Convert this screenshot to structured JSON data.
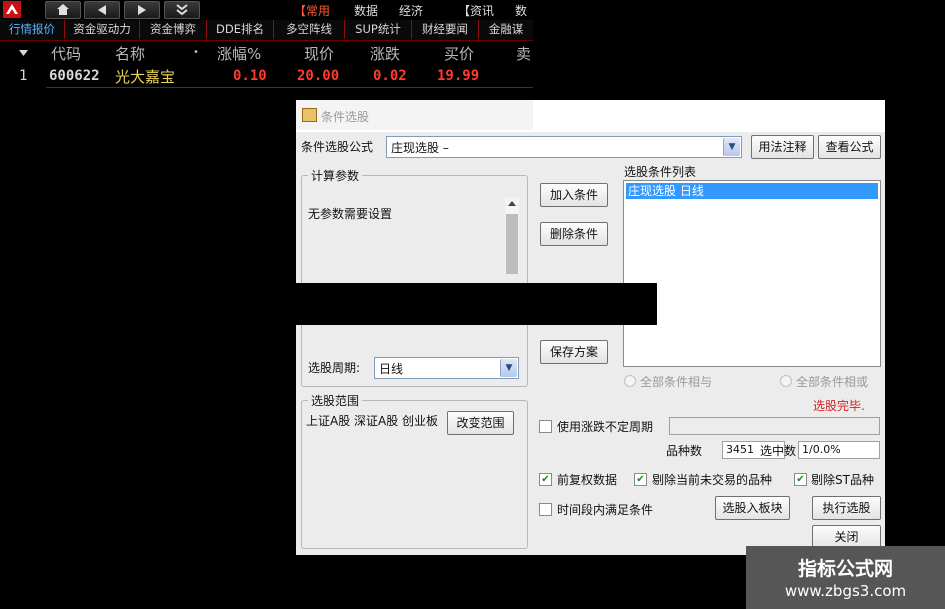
{
  "toolbar": {
    "home_icon": "home-icon",
    "back_icon": "triangle-left-icon",
    "forward_icon": "triangle-right-icon",
    "more_icon": "double-chevron-down-icon",
    "menu": [
      {
        "label": "【常用",
        "active": true
      },
      {
        "label": "数据"
      },
      {
        "label": "经济"
      },
      {
        "label": "【资讯"
      },
      {
        "label": "数"
      }
    ]
  },
  "tabs": [
    "行情报价",
    "资金驱动力",
    "资金博弈",
    "DDE排名",
    "多空阵线",
    "SUP统计",
    "财经要闻",
    "金融谋"
  ],
  "quote_table": {
    "columns": [
      "代码",
      "名称",
      "•",
      "涨幅%",
      "现价",
      "涨跌",
      "买价",
      "卖"
    ],
    "rows": [
      {
        "index": "1",
        "code": "600622",
        "name": "光大嘉宝",
        "change_pct": "0.10",
        "price": "20.00",
        "change": "0.02",
        "bid": "19.99"
      }
    ]
  },
  "dialog": {
    "title": "条件选股",
    "formula_label": "条件选股公式",
    "formula_value": "庄现选股    –",
    "usage_button": "用法注释",
    "view_formula_button": "查看公式",
    "params_group": "计算参数",
    "params_text": "无参数需要设置",
    "add_condition_button": "加入条件",
    "delete_condition_button": "删除条件",
    "save_plan_button": "保存方案",
    "condition_list_label": "选股条件列表",
    "condition_list_items": [
      "庄现选股   日线"
    ],
    "period_label": "选股周期:",
    "period_value": "日线",
    "radio_and": "全部条件相与",
    "radio_or": "全部条件相或",
    "status_text": "选股完毕.",
    "range_group": "选股范围",
    "range_text": "上证A股 深证A股 创业板",
    "change_range_button": "改变范围",
    "use_period_label": "使用涨跌不定周期",
    "count_label": "品种数",
    "count_value": "3451",
    "selected_label": "选中数",
    "selected_value": "1/0.0%",
    "adjusted_label": "前复权数据",
    "exclude_untraded_label": "剔除当前未交易的品种",
    "exclude_st_label": "剔除ST品种",
    "time_segment_label": "时间段内满足条件",
    "to_block_button": "选股入板块",
    "execute_button": "执行选股",
    "close_button": "关闭"
  },
  "watermark": {
    "line1": "指标公式网",
    "line2": "www.zbgs3.com"
  }
}
